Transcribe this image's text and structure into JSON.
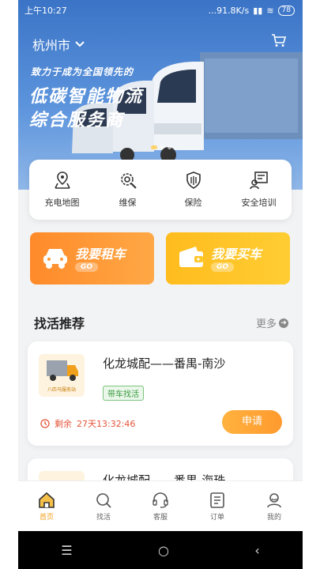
{
  "status_bar": {
    "time": "上午10:27",
    "network_speed": "...91.8K/s",
    "battery": "78"
  },
  "header": {
    "city": "杭州市"
  },
  "banner": {
    "slogan_small": "致力于成为全国领先的",
    "slogan_line1": "低碳智能物流",
    "slogan_line2": "综合服务商"
  },
  "services": [
    {
      "label": "充电地图",
      "icon": "map-pin-icon"
    },
    {
      "label": "维保",
      "icon": "maintenance-gear-icon"
    },
    {
      "label": "保险",
      "icon": "shield-icon"
    },
    {
      "label": "安全培训",
      "icon": "training-icon"
    }
  ],
  "promos": {
    "rent": {
      "title": "我要租车",
      "go": "GO"
    },
    "buy": {
      "title": "我要买车",
      "go": "GO"
    }
  },
  "section": {
    "title": "找活推荐",
    "more": "更多"
  },
  "jobs": [
    {
      "title": "化龙城配——番禺-南沙",
      "tag": "带车找活",
      "remaining_label": "剩余",
      "remaining_time": "27天13:32:46",
      "apply": "申请",
      "thumb_caption": "八匹马服务站"
    },
    {
      "title": "化龙城配——番禺-海珠"
    }
  ],
  "tabbar": [
    {
      "label": "首页",
      "icon": "home-icon",
      "active": true
    },
    {
      "label": "找活",
      "icon": "search-icon"
    },
    {
      "label": "客服",
      "icon": "headset-icon"
    },
    {
      "label": "订单",
      "icon": "order-list-icon"
    },
    {
      "label": "我的",
      "icon": "profile-icon"
    }
  ],
  "nav": {
    "menu": "☰",
    "home": "○",
    "back": "‹"
  },
  "colors": {
    "accent": "#f0a01b",
    "hero_blue": "#3b74c6",
    "rent_orange": "#ff8a2a",
    "buy_yellow": "#ffbc1e",
    "timer_red": "#e4543a"
  }
}
